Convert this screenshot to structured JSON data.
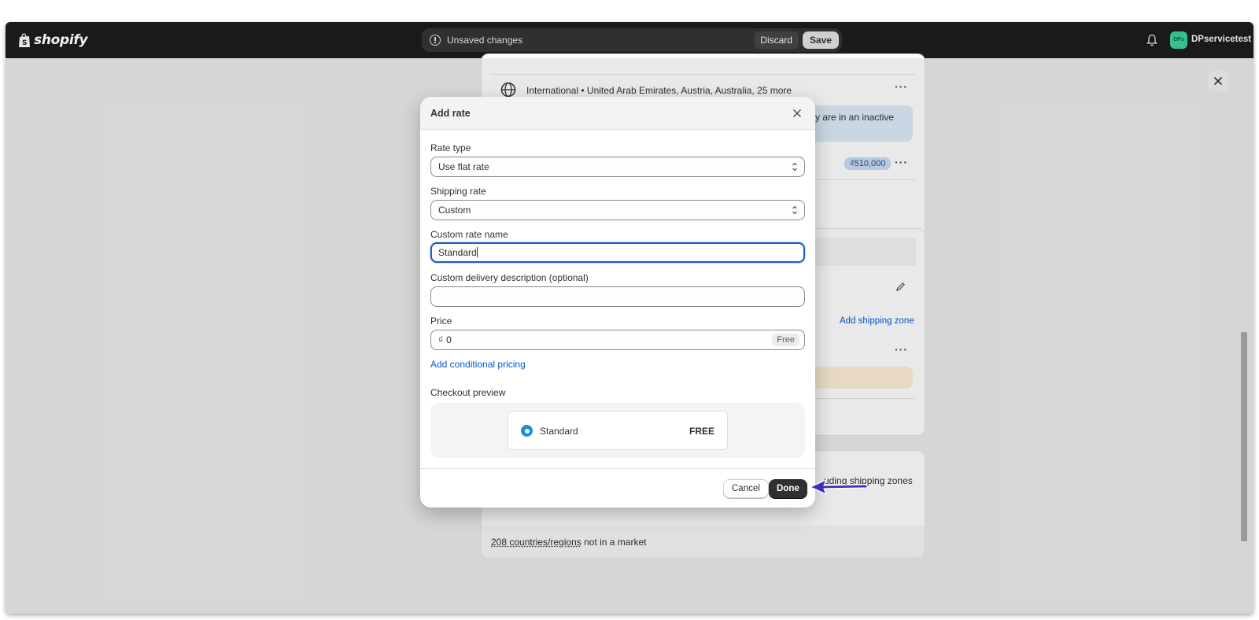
{
  "app": {
    "logo_text": "shopify",
    "store_name": "DPservicetest",
    "avatar_initials": "DPs"
  },
  "savebar": {
    "message": "Unsaved changes",
    "discard_label": "Discard",
    "save_label": "Save"
  },
  "background": {
    "zone_line": "International • United Arab Emirates, Austria, Australia, 25 more",
    "banner_text": "y are in an inactive",
    "rate_price": "₫510,000",
    "add_zone_link": "Add shipping zone",
    "excluding_text": "uding shipping zones",
    "countries_link": "208 countries/regions",
    "countries_suffix": "not in a market"
  },
  "modal": {
    "title": "Add rate",
    "rate_type": {
      "label": "Rate type",
      "value": "Use flat rate"
    },
    "shipping_rate": {
      "label": "Shipping rate",
      "value": "Custom"
    },
    "custom_name": {
      "label": "Custom rate name",
      "value": "Standard"
    },
    "custom_description": {
      "label": "Custom delivery description (optional)",
      "value": ""
    },
    "price": {
      "label": "Price",
      "currency": "₫",
      "value": "0",
      "badge": "Free"
    },
    "conditional_link": "Add conditional pricing",
    "preview": {
      "label": "Checkout preview",
      "rate_name": "Standard",
      "rate_price": "FREE"
    },
    "cancel_label": "Cancel",
    "done_label": "Done"
  },
  "colors": {
    "topbar": "#1a1a1a",
    "link": "#005bd3",
    "focus": "#1f5cc0",
    "primary_button": "#303030",
    "radio": "#1a8fd6",
    "annotation_arrow": "#3b2fb5"
  }
}
